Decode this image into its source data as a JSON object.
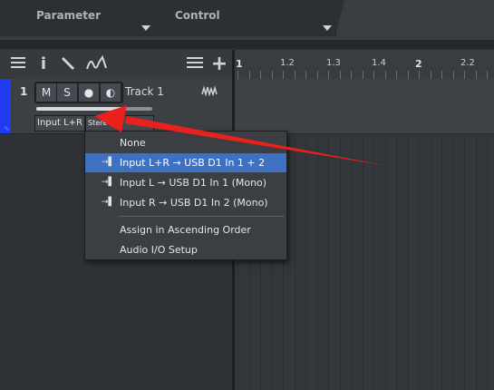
{
  "header": {
    "parameter_label": "Parameter",
    "control_label": "Control"
  },
  "toolbar": {
    "icons": [
      "list-view-icon",
      "info-icon",
      "wrench-icon",
      "automation-curve-icon",
      "list-options-icon",
      "add-icon"
    ]
  },
  "track": {
    "number": "1",
    "mute_label": "M",
    "solo_label": "S",
    "record_glyph": "●",
    "monitor_glyph": "◐",
    "name": "Track 1",
    "input_label": "Input L+R",
    "channel_mode_label": "Stere",
    "color": "#1f3cf0",
    "volume_level": 0.77
  },
  "ruler": {
    "labels": [
      {
        "text": "1",
        "major": true
      },
      {
        "text": "1.2",
        "major": false
      },
      {
        "text": "1.3",
        "major": false
      },
      {
        "text": "1.4",
        "major": false
      },
      {
        "text": "2",
        "major": true
      },
      {
        "text": "2.2",
        "major": false
      }
    ]
  },
  "menu": {
    "items": [
      {
        "label": "None",
        "icon": "",
        "selected": false
      },
      {
        "label": "Input L+R → USB D1 In 1 + 2",
        "icon": "input-icon",
        "selected": true
      },
      {
        "label": "Input L → USB D1 In 1 (Mono)",
        "icon": "input-icon",
        "selected": false
      },
      {
        "label": "Input R → USB D1 In 2 (Mono)",
        "icon": "input-icon",
        "selected": false
      },
      {
        "label": "Assign in Ascending Order",
        "icon": "",
        "selected": false
      },
      {
        "label": "Audio I/O Setup",
        "icon": "",
        "selected": false
      }
    ],
    "selected_color": "#3f71c2"
  },
  "annotation": {
    "color": "#e8211c"
  }
}
